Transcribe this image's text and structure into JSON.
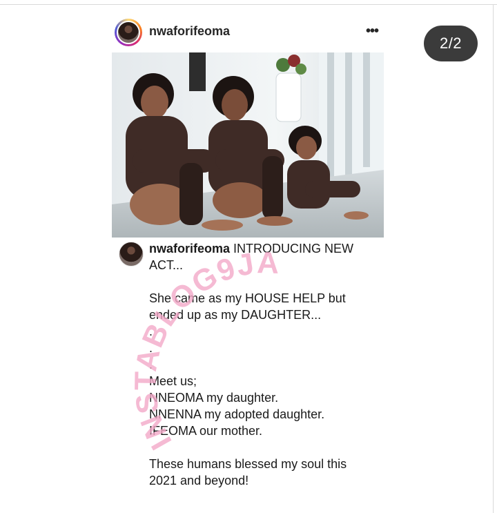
{
  "counter": "2/2",
  "post": {
    "username": "nwaforifeoma",
    "more_icon": "more-horizontal-icon",
    "photo_alt": "three people in matching dark outfits and hair curlers seated on the floor",
    "caption": {
      "username": "nwaforifeoma",
      "first_line": " INTRODUCING NEW ACT...",
      "lines": [
        "",
        "She came as my HOUSE HELP but ended up as my DAUGHTER...",
        ".",
        ".",
        ".",
        "Meet us;",
        "NNEOMA my daughter.",
        "NNENNA my adopted daughter.",
        "IFEOMA our mother.",
        "",
        "These humans blessed my soul this 2021 and beyond!"
      ]
    }
  },
  "watermark": {
    "text": "INSTABLOG9JA",
    "color": "#f2a9c8"
  },
  "colors": {
    "counter_bg": "#3b3b3b",
    "text": "#1a1a1a",
    "outfit": "#3f2b26"
  }
}
